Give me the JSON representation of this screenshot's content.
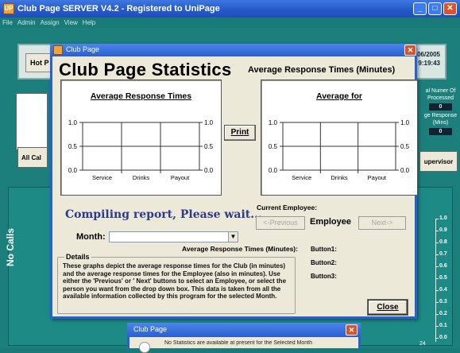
{
  "app": {
    "title": "Club Page SERVER V4.2 - Registered to UniPage",
    "logo_text": "UP",
    "menu": [
      "File",
      "Admin",
      "Assign",
      "View",
      "Help"
    ],
    "hot_button_label": "Hot P",
    "date_time": [
      "/06/2005",
      "9:19:43"
    ],
    "all_calls_label": "All Cal",
    "stats": {
      "number_processed_label": "al Numer Of Processed",
      "number_processed_value": "0",
      "avg_response_label": "ge Response (Mins)",
      "avg_response_value": "0"
    },
    "supervisor_label": "upervisor",
    "no_calls_label": "No Calls",
    "right_axis_ticks": [
      "1.0",
      "0.9",
      "0.8",
      "0.7",
      "0.6",
      "0.5",
      "0.4",
      "0.3",
      "0.2",
      "0.1",
      "0.0"
    ],
    "axis_24": "24"
  },
  "dialog": {
    "window_title": "Club Page",
    "title": "Club Page Statistics",
    "subtitle": "Average Response Times (Minutes)",
    "print_label": "Print",
    "compiling_text": "Compiling report, Please wait...",
    "current_employee_label": "Current Employee:",
    "previous_label": "<-Previous",
    "employee_label": "Employee",
    "next_label": "Next->",
    "month_label": "Month:",
    "month_value": "",
    "avg_resp_minutes_label": "Average Response Times (Minutes):",
    "button1_label": "Button1:",
    "button2_label": "Button2:",
    "button3_label": "Button3:",
    "details_legend": "Details",
    "details_text": "These graphs depict the average response times for the Club (in minutes) and the average response times for the Employee (also in minutes). Use either the 'Previous' or ' Next' buttons to select an Employee, or select the person you want from the drop down box. This data is taken from all the available information collected by this program for the selected Month.",
    "close_label": "Close"
  },
  "dialog2": {
    "window_title": "Club Page",
    "message": "No Statistics are available at present for the Selected Month"
  },
  "chart_data": [
    {
      "type": "bar",
      "title": "Average Response Times",
      "categories": [
        "Service",
        "Drinks",
        "Payout"
      ],
      "values": [
        0,
        0,
        0
      ],
      "ylim": [
        0,
        1
      ],
      "y_ticks": [
        "0.0",
        "0.5",
        "1.0"
      ],
      "grid": true
    },
    {
      "type": "bar",
      "title": "Average for",
      "categories": [
        "Service",
        "Drinks",
        "Payout"
      ],
      "values": [
        0,
        0,
        0
      ],
      "ylim": [
        0,
        1
      ],
      "y_ticks": [
        "0.0",
        "0.5",
        "1.0"
      ],
      "grid": true
    }
  ]
}
